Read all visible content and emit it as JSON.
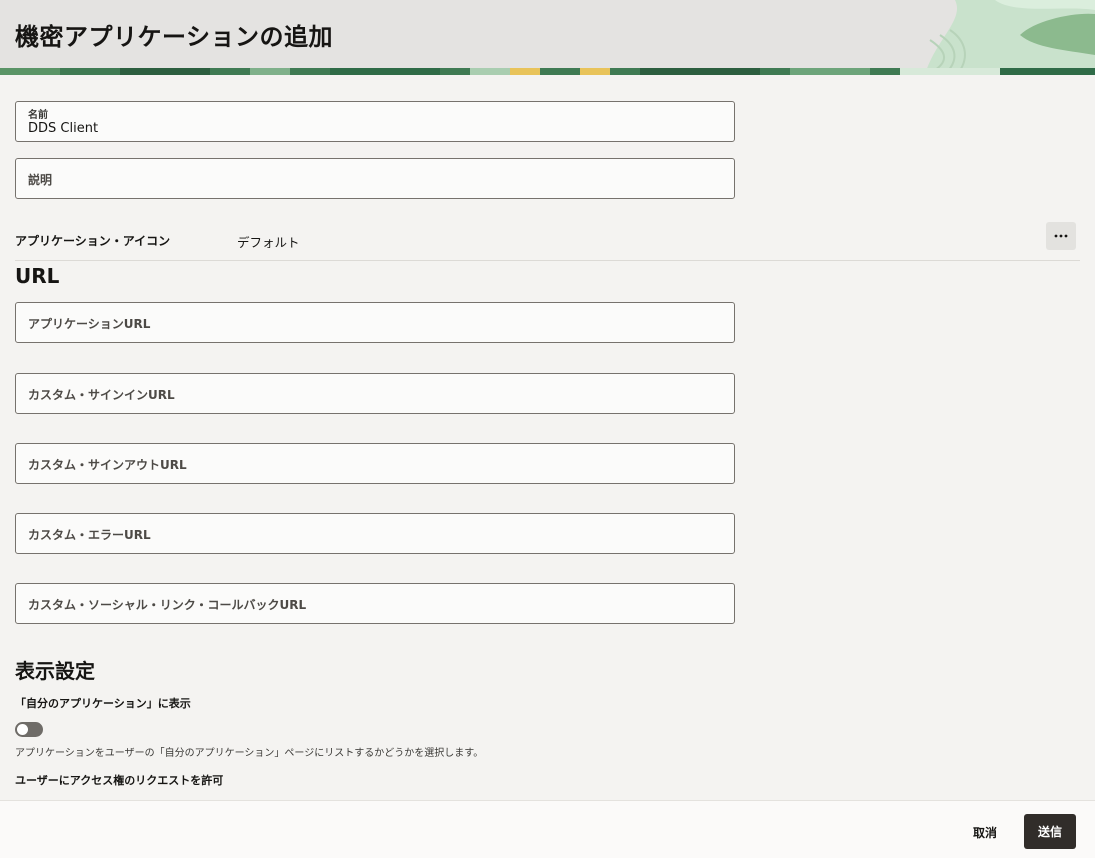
{
  "header": {
    "title": "機密アプリケーションの追加"
  },
  "form": {
    "name": {
      "label": "名前",
      "value": "DDS Client"
    },
    "description": {
      "label": "説明",
      "value": ""
    },
    "app_icon": {
      "label": "アプリケーション・アイコン",
      "value": "デフォルト",
      "more_icon": "more-horizontal-icon"
    }
  },
  "url_section": {
    "title": "URL",
    "fields": [
      {
        "label": "アプリケーションURL",
        "value": ""
      },
      {
        "label": "カスタム・サインインURL",
        "value": ""
      },
      {
        "label": "カスタム・サインアウトURL",
        "value": ""
      },
      {
        "label": "カスタム・エラーURL",
        "value": ""
      },
      {
        "label": "カスタム・ソーシャル・リンク・コールバックURL",
        "value": ""
      }
    ]
  },
  "display_section": {
    "title": "表示設定",
    "show_in_my_apps": {
      "label": "「自分のアプリケーション」に表示",
      "enabled": false,
      "help": "アプリケーションをユーザーの「自分のアプリケーション」ページにリストするかどうかを選択します。"
    },
    "allow_access_request": {
      "label": "ユーザーにアクセス権のリクエストを許可"
    }
  },
  "footer": {
    "cancel_label": "取消",
    "submit_label": "送信"
  },
  "colors": {
    "header_bg": "#e4e3e1",
    "page_bg": "#f4f3f1",
    "primary_button": "#312d2a",
    "band_green": "#2f6b47",
    "band_yellow": "#e8c35a"
  }
}
